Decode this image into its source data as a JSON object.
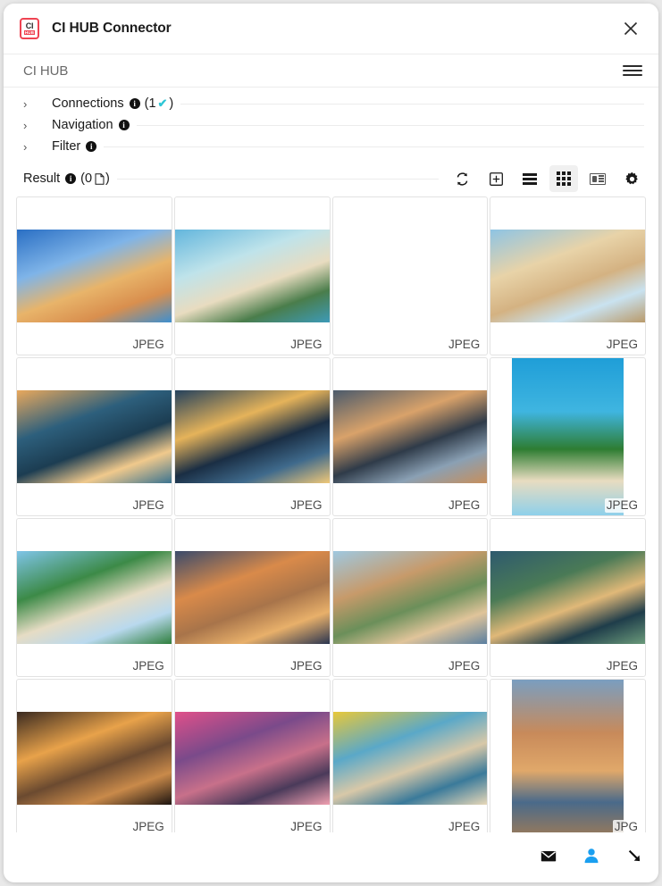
{
  "window": {
    "title": "CI HUB Connector",
    "logo_top": "CI",
    "logo_bottom": "HUB",
    "close_icon": "close-icon"
  },
  "subheader": {
    "title": "CI HUB",
    "menu_icon": "hamburger-menu-icon"
  },
  "panels": [
    {
      "label": "Connections",
      "chevron": "›",
      "info_icon": "info-icon",
      "suffix_open": "(1",
      "check": "✔",
      "suffix_close": ")",
      "has_count": true
    },
    {
      "label": "Navigation",
      "chevron": "›",
      "info_icon": "info-icon",
      "has_count": false
    },
    {
      "label": "Filter",
      "chevron": "›",
      "info_icon": "info-icon",
      "has_count": false
    }
  ],
  "result": {
    "label": "Result",
    "info_icon": "info-icon",
    "count_open": "(0",
    "count_close": ")",
    "document_icon": "document-icon"
  },
  "toolbar": [
    {
      "name": "refresh-button",
      "icon": "refresh-icon",
      "active": false
    },
    {
      "name": "add-asset-button",
      "icon": "plus-box-icon",
      "active": false
    },
    {
      "name": "list-view-button",
      "icon": "list-icon",
      "active": false
    },
    {
      "name": "grid-view-button",
      "icon": "grid-icon",
      "active": true
    },
    {
      "name": "card-view-button",
      "icon": "card-icon",
      "active": false
    },
    {
      "name": "settings-button",
      "icon": "gear-icon",
      "active": false
    }
  ],
  "assets": [
    {
      "format": "JPEG",
      "orientation": "landscape",
      "alt": "canal-with-colorful-houses-and-bridge",
      "palette": [
        "#2a6fc4",
        "#7fb4e8",
        "#e8b46a",
        "#d98f4e",
        "#3d8fd0"
      ]
    },
    {
      "format": "JPEG",
      "orientation": "landscape",
      "alt": "tropical-beach-with-limestone-karst",
      "palette": [
        "#63b6dd",
        "#bfe3ea",
        "#e8dcc0",
        "#4a7d4b",
        "#3d9ab8"
      ]
    },
    {
      "format": "JPEG",
      "orientation": "landscape",
      "alt": "beach-swing-at-sunset-with-palm",
      "palette": [
        "#3b8fb8",
        "#e7a druk",
        "#f0b488",
        "#6b4a3a",
        "#d98a6a"
      ]
    },
    {
      "format": "JPEG",
      "orientation": "landscape",
      "alt": "sand-castle-palace-with-blue-sky",
      "palette": [
        "#8ec4e4",
        "#e8d3a8",
        "#d4b282",
        "#c9e2f0",
        "#b99a6a"
      ]
    },
    {
      "format": "JPEG",
      "orientation": "landscape",
      "alt": "beach-with-umbrellas-at-golden-sunset",
      "palette": [
        "#e9a85c",
        "#2d5f7c",
        "#1c3d52",
        "#f0c98c",
        "#3a7390"
      ]
    },
    {
      "format": "JPEG",
      "orientation": "landscape",
      "alt": "coastal-city-at-night-with-lights",
      "palette": [
        "#24415c",
        "#e5b35a",
        "#1a2e44",
        "#3f6a8c",
        "#f0c878"
      ]
    },
    {
      "format": "JPEG",
      "orientation": "landscape",
      "alt": "rocky-shoreline-under-dramatic-clouds",
      "palette": [
        "#4b5a6b",
        "#d9a26a",
        "#2f3b49",
        "#8aa0b4",
        "#c78f5c"
      ]
    },
    {
      "format": "JPEG",
      "orientation": "portrait",
      "alt": "hammock-between-two-palm-trees",
      "palette": [
        "#1f9ed8",
        "#3fb5e0",
        "#2e7d32",
        "#e8dcc0",
        "#8ed0ea"
      ]
    },
    {
      "format": "JPEG",
      "orientation": "landscape",
      "alt": "palm-lined-beach-with-couple-walking",
      "palette": [
        "#7ec4e8",
        "#3c8a47",
        "#e6dcc4",
        "#b9d9ee",
        "#2f7f3d"
      ]
    },
    {
      "format": "JPEG",
      "orientation": "landscape",
      "alt": "colosseum-at-dusk-in-rome",
      "palette": [
        "#3a4a6b",
        "#d98a4a",
        "#a8744a",
        "#e8b06a",
        "#2a3550"
      ]
    },
    {
      "format": "JPEG",
      "orientation": "landscape",
      "alt": "hilltop-village-with-mountains",
      "palette": [
        "#9fc8e0",
        "#c79a6a",
        "#6b8f5a",
        "#e0c49a",
        "#5a7fa0"
      ]
    },
    {
      "format": "JPEG",
      "orientation": "landscape",
      "alt": "luxury-villa-with-pool-at-twilight",
      "palette": [
        "#2e5a6e",
        "#4a7a56",
        "#e0b878",
        "#1f3d4a",
        "#6a9a7a"
      ]
    },
    {
      "format": "JPEG",
      "orientation": "landscape",
      "alt": "sunset-reflection-on-wet-beach",
      "palette": [
        "#3a2a20",
        "#e8a24a",
        "#6b4a30",
        "#c98a4a",
        "#1c1410"
      ]
    },
    {
      "format": "JPEG",
      "orientation": "landscape",
      "alt": "pink-sunset-over-rocky-coast",
      "palette": [
        "#e0508a",
        "#7a4a8a",
        "#c8708a",
        "#4a3a5a",
        "#f0a0b0"
      ]
    },
    {
      "format": "JPEG",
      "orientation": "landscape",
      "alt": "woman-in-yellow-dress-overlooking-bay",
      "palette": [
        "#e8c83a",
        "#5aa8c8",
        "#d8c8a8",
        "#3a7a9a",
        "#e8d8b8"
      ]
    },
    {
      "format": "JPG",
      "orientation": "portrait",
      "alt": "mediterranean-hill-town-with-mountains",
      "palette": [
        "#7a9ec0",
        "#c88a5a",
        "#e0a86a",
        "#4a6a8a",
        "#9a7a5a"
      ]
    }
  ],
  "footer": [
    {
      "name": "mail-button",
      "icon": "envelope-icon",
      "color": "#111111"
    },
    {
      "name": "account-button",
      "icon": "user-icon",
      "color": "#1a9ff0"
    },
    {
      "name": "resize-handle",
      "icon": "resize-arrow-icon",
      "color": "#111111"
    }
  ],
  "colors": {
    "brand_red": "#ef4352",
    "accent_check": "#2ec6d6",
    "accent_blue": "#1a9ff0",
    "border": "#e2e2e2",
    "active_bg": "#f0f0f0"
  }
}
